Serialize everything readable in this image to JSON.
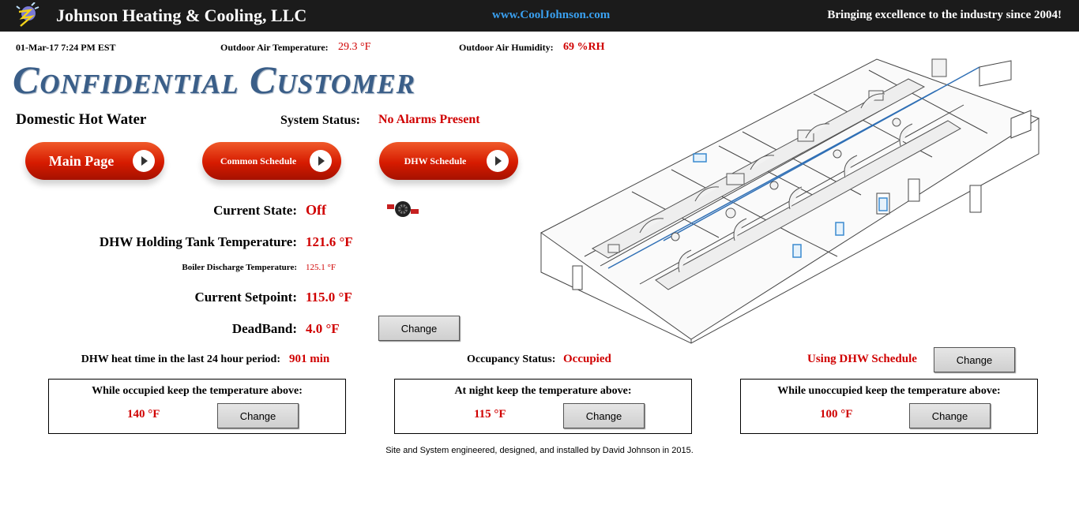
{
  "header": {
    "company": "Johnson Heating & Cooling, LLC",
    "website": "www.CoolJohnson.com",
    "tagline": "Bringing excellence to the industry since 2004!"
  },
  "infobar": {
    "datetime": "01-Mar-17 7:24 PM EST",
    "oat_label": "Outdoor Air Temperature:",
    "oat_value": "29.3 °F",
    "oah_label": "Outdoor Air Humidity:",
    "oah_value": "69 %RH"
  },
  "customer": "Confidential Customer",
  "page": {
    "title": "Domestic Hot Water",
    "system_status_label": "System Status:",
    "system_status_value": "No Alarms Present"
  },
  "nav": {
    "main": "Main Page",
    "common": "Common Schedule",
    "dhw": "DHW Schedule"
  },
  "readings": {
    "state_label": "Current State:",
    "state_value": "Off",
    "tank_label": "DHW Holding Tank Temperature:",
    "tank_value": "121.6 °F",
    "boiler_label": "Boiler Discharge Temperature:",
    "boiler_value": "125.1 °F",
    "setpoint_label": "Current Setpoint:",
    "setpoint_value": "115.0 °F",
    "deadband_label": "DeadBand:",
    "deadband_value": "4.0 °F",
    "heat_time_label": "DHW heat time in the last 24 hour period:",
    "heat_time_value": "901 min",
    "occupancy_label": "Occupancy Status:",
    "occupancy_value": "Occupied",
    "schedule_mode": "Using DHW Schedule"
  },
  "buttons": {
    "change": "Change"
  },
  "setpoint_boxes": [
    {
      "heading": "While occupied keep the temperature above:",
      "value": "140 °F"
    },
    {
      "heading": "At night keep the temperature above:",
      "value": "115 °F"
    },
    {
      "heading": "While unoccupied keep the temperature above:",
      "value": "100 °F"
    }
  ],
  "footer": "Site and System engineered, designed, and installed by David Johnson in 2015.",
  "icons": [
    "logo-icon",
    "pump-icon",
    "building-diagram"
  ],
  "colors": {
    "topbar": "#1b1b1b",
    "accent_red": "#d00000",
    "website_blue": "#3aa0f0",
    "title_blue": "#3a5e88",
    "button_red": "#d61b00"
  }
}
